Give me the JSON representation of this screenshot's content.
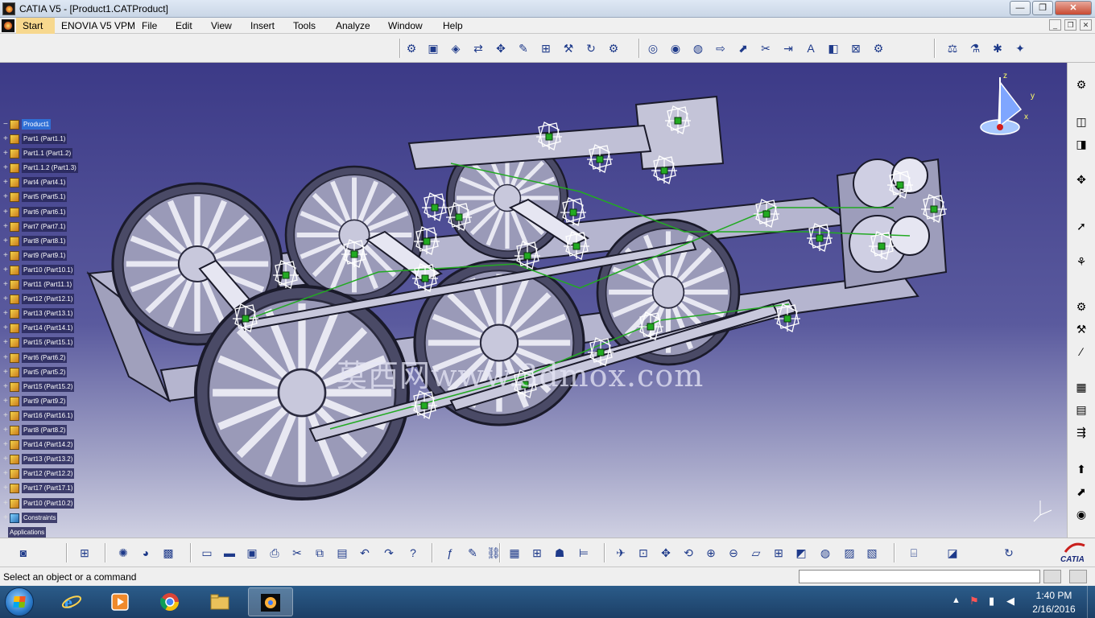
{
  "window": {
    "title": "CATIA V5 - [Product1.CATProduct]"
  },
  "menubar": {
    "items": [
      "Start",
      "ENOVIA V5 VPM",
      "File",
      "Edit",
      "View",
      "Insert",
      "Tools",
      "Analyze",
      "Window",
      "Help"
    ]
  },
  "spec_tree": {
    "root": "Product1",
    "items": [
      "Part1 (Part1.1)",
      "Part1.1 (Part1.2)",
      "Part1.1.2 (Part1.3)",
      "Part4 (Part4.1)",
      "Part5 (Part5.1)",
      "Part6 (Part6.1)",
      "Part7 (Part7.1)",
      "Part8 (Part8.1)",
      "Part9 (Part9.1)",
      "Part10 (Part10.1)",
      "Part11 (Part11.1)",
      "Part12 (Part12.1)",
      "Part13 (Part13.1)",
      "Part14 (Part14.1)",
      "Part15 (Part15.1)",
      "Part6 (Part6.2)",
      "Part5 (Part5.2)",
      "Part15 (Part15.2)",
      "Part9 (Part9.2)",
      "Part16 (Part16.1)",
      "Part8 (Part8.2)",
      "Part14 (Part14.2)",
      "Part13 (Part13.2)",
      "Part12 (Part12.2)",
      "Part17 (Part17.1)",
      "Part10 (Part10.2)"
    ],
    "constraints": "Constraints",
    "applications": "Applications"
  },
  "compass": {
    "z": "z",
    "y": "y",
    "x": "x"
  },
  "watermark": "莫西网www.3dmox.com",
  "statusbar": {
    "text": "Select an object or a command"
  },
  "taskbar": {
    "time": "1:40 PM",
    "date": "2/16/2016",
    "apps": [
      "internet-explorer",
      "media-player",
      "chrome",
      "file-explorer",
      "catia"
    ]
  },
  "colors": {
    "viewport_top": "#3c3a87",
    "viewport_bottom": "#cfd0e2",
    "constraint_green": "#22aa22",
    "part_fill": "#a8a8c4"
  }
}
